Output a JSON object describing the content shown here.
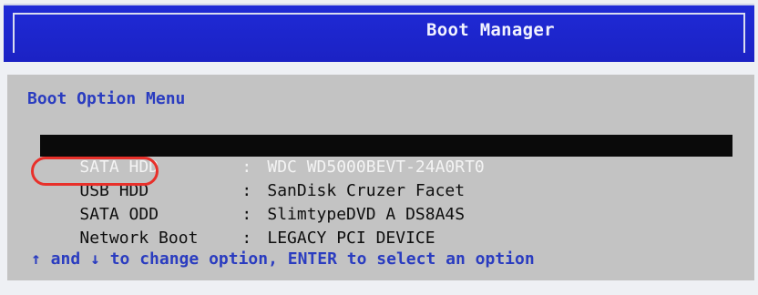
{
  "header": {
    "title": "Boot Manager"
  },
  "menu": {
    "heading": "Boot Option Menu",
    "separator": ":",
    "options": [
      {
        "label": "SATA HDD",
        "device": "WDC WD5000BEVT-24A0RT0",
        "selected": true
      },
      {
        "label": "USB HDD",
        "device": "SanDisk Cruzer Facet",
        "selected": false
      },
      {
        "label": "SATA ODD",
        "device": "SlimtypeDVD A DS8A4S",
        "selected": false
      },
      {
        "label": "Network Boot",
        "device": "LEGACY PCI DEVICE",
        "selected": false
      }
    ]
  },
  "help": {
    "text": "↑ and ↓ to change option, ENTER to select an option"
  },
  "annotation": {
    "highlighted_option": "USB HDD",
    "color": "#e8302a"
  },
  "colors": {
    "title_bar": "#1f2ad6",
    "panel": "#c3c3c3",
    "menu_text": "#2a3cc0",
    "selected_bg": "#0a0a0a"
  }
}
